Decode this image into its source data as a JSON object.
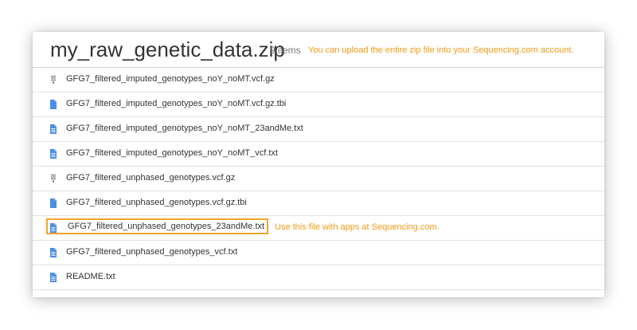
{
  "archive": {
    "title": "my_raw_genetic_data.zip",
    "item_count": "9 items",
    "upload_note": "You can upload the entire zip file into your Sequencing.com account."
  },
  "files": [
    {
      "name": "GFG7_filtered_imputed_genotypes_noY_noMT.vcf.gz",
      "icon": "archive-icon"
    },
    {
      "name": "GFG7_filtered_imputed_genotypes_noY_noMT.vcf.gz.tbi",
      "icon": "file-icon"
    },
    {
      "name": "GFG7_filtered_imputed_genotypes_noY_noMT_23andMe.txt",
      "icon": "text-file-icon"
    },
    {
      "name": "GFG7_filtered_imputed_genotypes_noY_noMT_vcf.txt",
      "icon": "text-file-icon"
    },
    {
      "name": "GFG7_filtered_unphased_genotypes.vcf.gz",
      "icon": "archive-icon"
    },
    {
      "name": "GFG7_filtered_unphased_genotypes.vcf.gz.tbi",
      "icon": "file-icon"
    },
    {
      "name": "GFG7_filtered_unphased_genotypes_23andMe.txt",
      "icon": "text-file-icon",
      "highlighted": true,
      "note": "Use this file with apps at Sequencing.com."
    },
    {
      "name": "GFG7_filtered_unphased_genotypes_vcf.txt",
      "icon": "text-file-icon"
    },
    {
      "name": "README.txt",
      "icon": "text-file-icon"
    }
  ],
  "colors": {
    "accent": "#f29a15",
    "highlight_border": "#f2a52c",
    "icon_blue": "#4a8fe2",
    "icon_gray": "#777777"
  }
}
